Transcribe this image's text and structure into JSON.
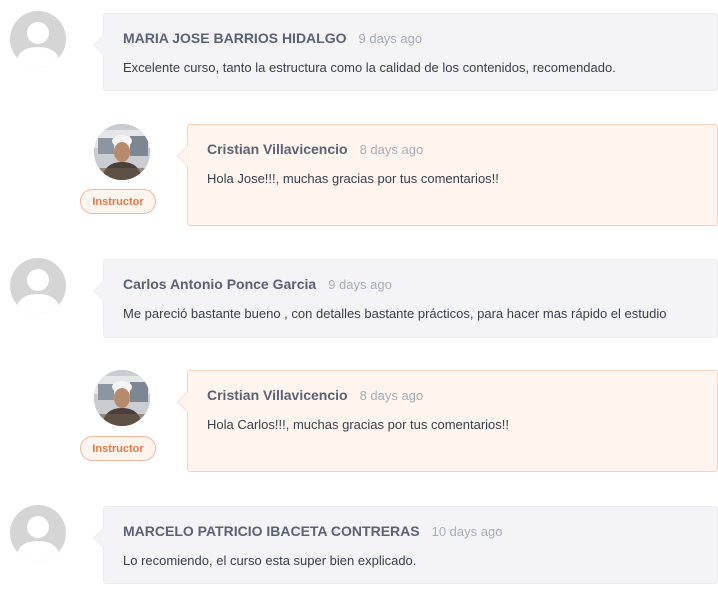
{
  "comments": [
    {
      "author": "MARIA JOSE BARRIOS HIDALGO",
      "time": "9 days ago",
      "text": "Excelente curso, tanto la estructura como la calidad de los contenidos, recomendado.",
      "avatar": "default-user-icon",
      "reply": {
        "author": "Cristian Villavicencio",
        "time": "8 days ago",
        "text": "Hola Jose!!!, muchas gracias por tus comentarios!!",
        "badge": "Instructor"
      }
    },
    {
      "author": "Carlos Antonio Ponce Garcia",
      "time": "9 days ago",
      "text": "Me pareció bastante bueno , con detalles bastante prácticos, para hacer mas rápido el estudio",
      "avatar": "default-user-icon",
      "reply": {
        "author": "Cristian Villavicencio",
        "time": "8 days ago",
        "text": "Hola Carlos!!!, muchas gracias por tus comentarios!!",
        "badge": "Instructor"
      }
    },
    {
      "author": "MARCELO PATRICIO IBACETA CONTRERAS",
      "time": "10 days ago",
      "text": "Lo recomiendo, el curso esta super bien explicado.",
      "avatar": "default-user-icon"
    }
  ],
  "colors": {
    "bubble_bg": "#f4f4f6",
    "instructor_bubble_bg": "#fff5ee",
    "instructor_accent": "#e0784a"
  }
}
